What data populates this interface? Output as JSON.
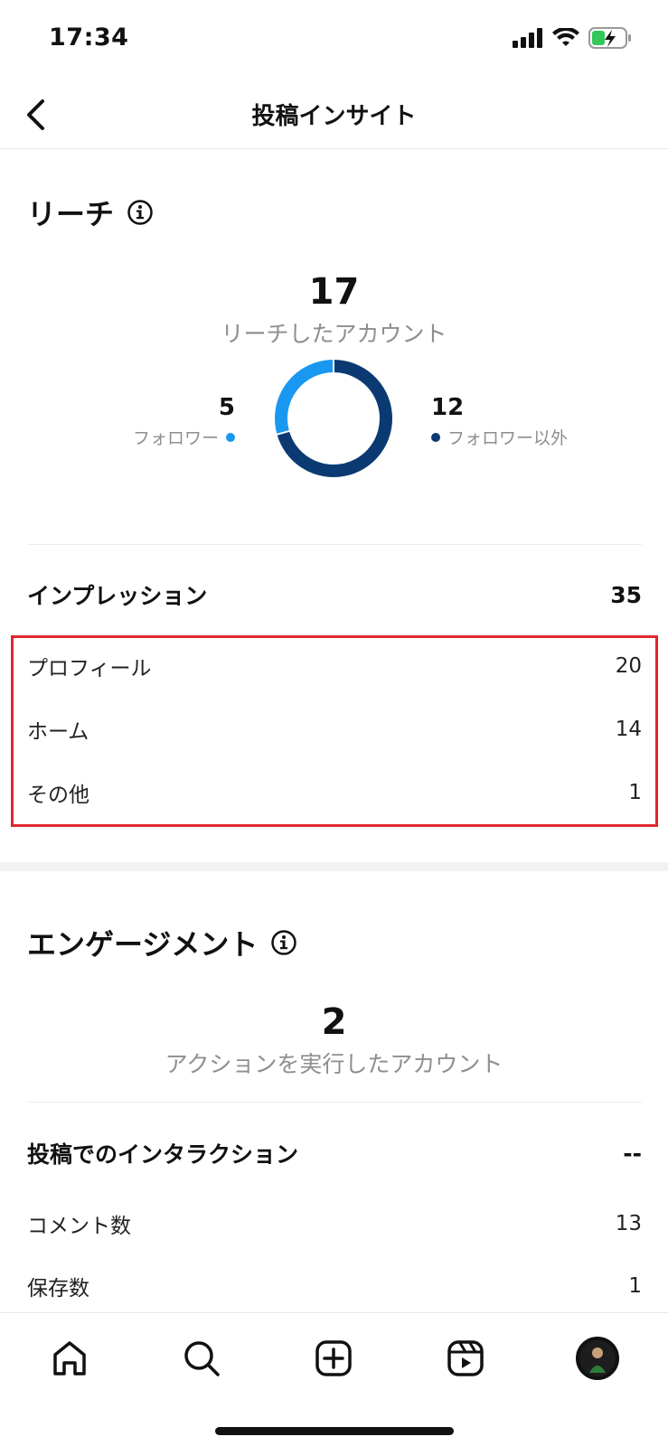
{
  "status_bar": {
    "time": "17:34",
    "icons": [
      "signal-icon",
      "wifi-icon",
      "battery-charging-icon"
    ]
  },
  "header": {
    "title": "投稿インサイト",
    "back_icon": "chevron-left-icon"
  },
  "reach": {
    "heading": "リーチ",
    "total": "17",
    "caption": "リーチしたアカウント",
    "followers_count": "5",
    "followers_label": "フォロワー",
    "non_followers_count": "12",
    "non_followers_label": "フォロワー以外"
  },
  "impressions": {
    "heading": "インプレッション",
    "total": "35",
    "rows": [
      {
        "label": "プロフィール",
        "value": "20"
      },
      {
        "label": "ホーム",
        "value": "14"
      },
      {
        "label": "その他",
        "value": "1"
      }
    ]
  },
  "engagement": {
    "heading": "エンゲージメント",
    "total": "2",
    "caption": "アクションを実行したアカウント",
    "interactions_heading": "投稿でのインタラクション",
    "interactions_value": "--",
    "rows": [
      {
        "label": "コメント数",
        "value": "13"
      },
      {
        "label": "保存数",
        "value": "1"
      }
    ]
  },
  "tab_bar": {
    "tabs": [
      "home-icon",
      "search-icon",
      "create-icon",
      "reels-icon",
      "profile-avatar"
    ]
  },
  "colors": {
    "followers": "#1a97f0",
    "non_followers": "#0b3a73",
    "highlight": "#e0262f"
  },
  "chart_data": {
    "type": "pie",
    "categories": [
      "フォロワー",
      "フォロワー以外"
    ],
    "values": [
      5,
      12
    ]
  }
}
